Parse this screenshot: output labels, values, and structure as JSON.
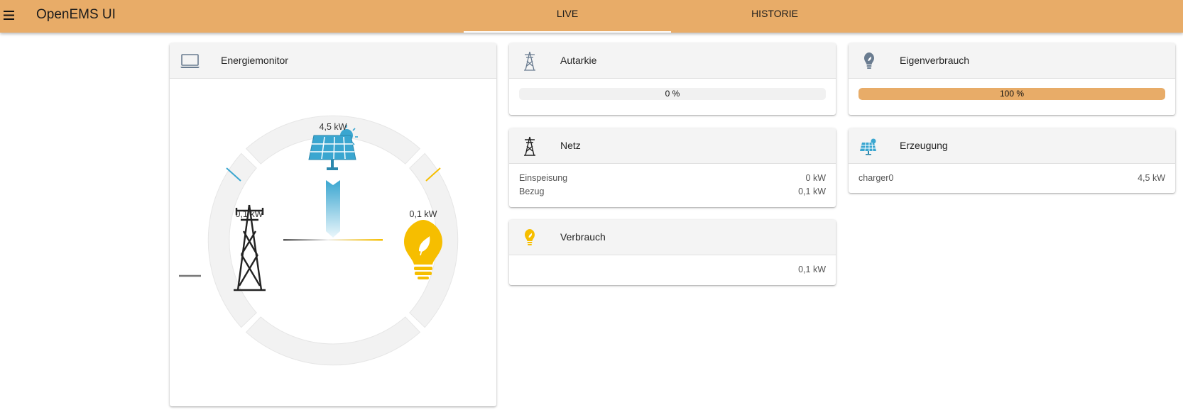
{
  "app": {
    "title": "OpenEMS UI"
  },
  "icons": {
    "menu": "menu-icon"
  },
  "colors": {
    "accent": "#e8ac68",
    "solar": "#3aa6d0",
    "consumption": "#f6be00",
    "grid": "#222222"
  },
  "tabs": [
    {
      "label": "LIVE",
      "active": true
    },
    {
      "label": "HISTORIE",
      "active": false
    }
  ],
  "energiemonitor": {
    "title": "Energiemonitor",
    "production_value": "4,5 kW",
    "grid_value": "0,1 kW",
    "consumption_value": "0,1 kW"
  },
  "autarkie": {
    "title": "Autarkie",
    "percent": 0,
    "label": "0 %"
  },
  "eigenverbrauch": {
    "title": "Eigenverbrauch",
    "percent": 100,
    "label": "100 %"
  },
  "netz": {
    "title": "Netz",
    "rows": [
      {
        "label": "Einspeisung",
        "value": "0 kW"
      },
      {
        "label": "Bezug",
        "value": "0,1 kW"
      }
    ]
  },
  "erzeugung": {
    "title": "Erzeugung",
    "rows": [
      {
        "label": "charger0",
        "value": "4,5 kW"
      }
    ]
  },
  "verbrauch": {
    "title": "Verbrauch",
    "value": "0,1 kW"
  }
}
